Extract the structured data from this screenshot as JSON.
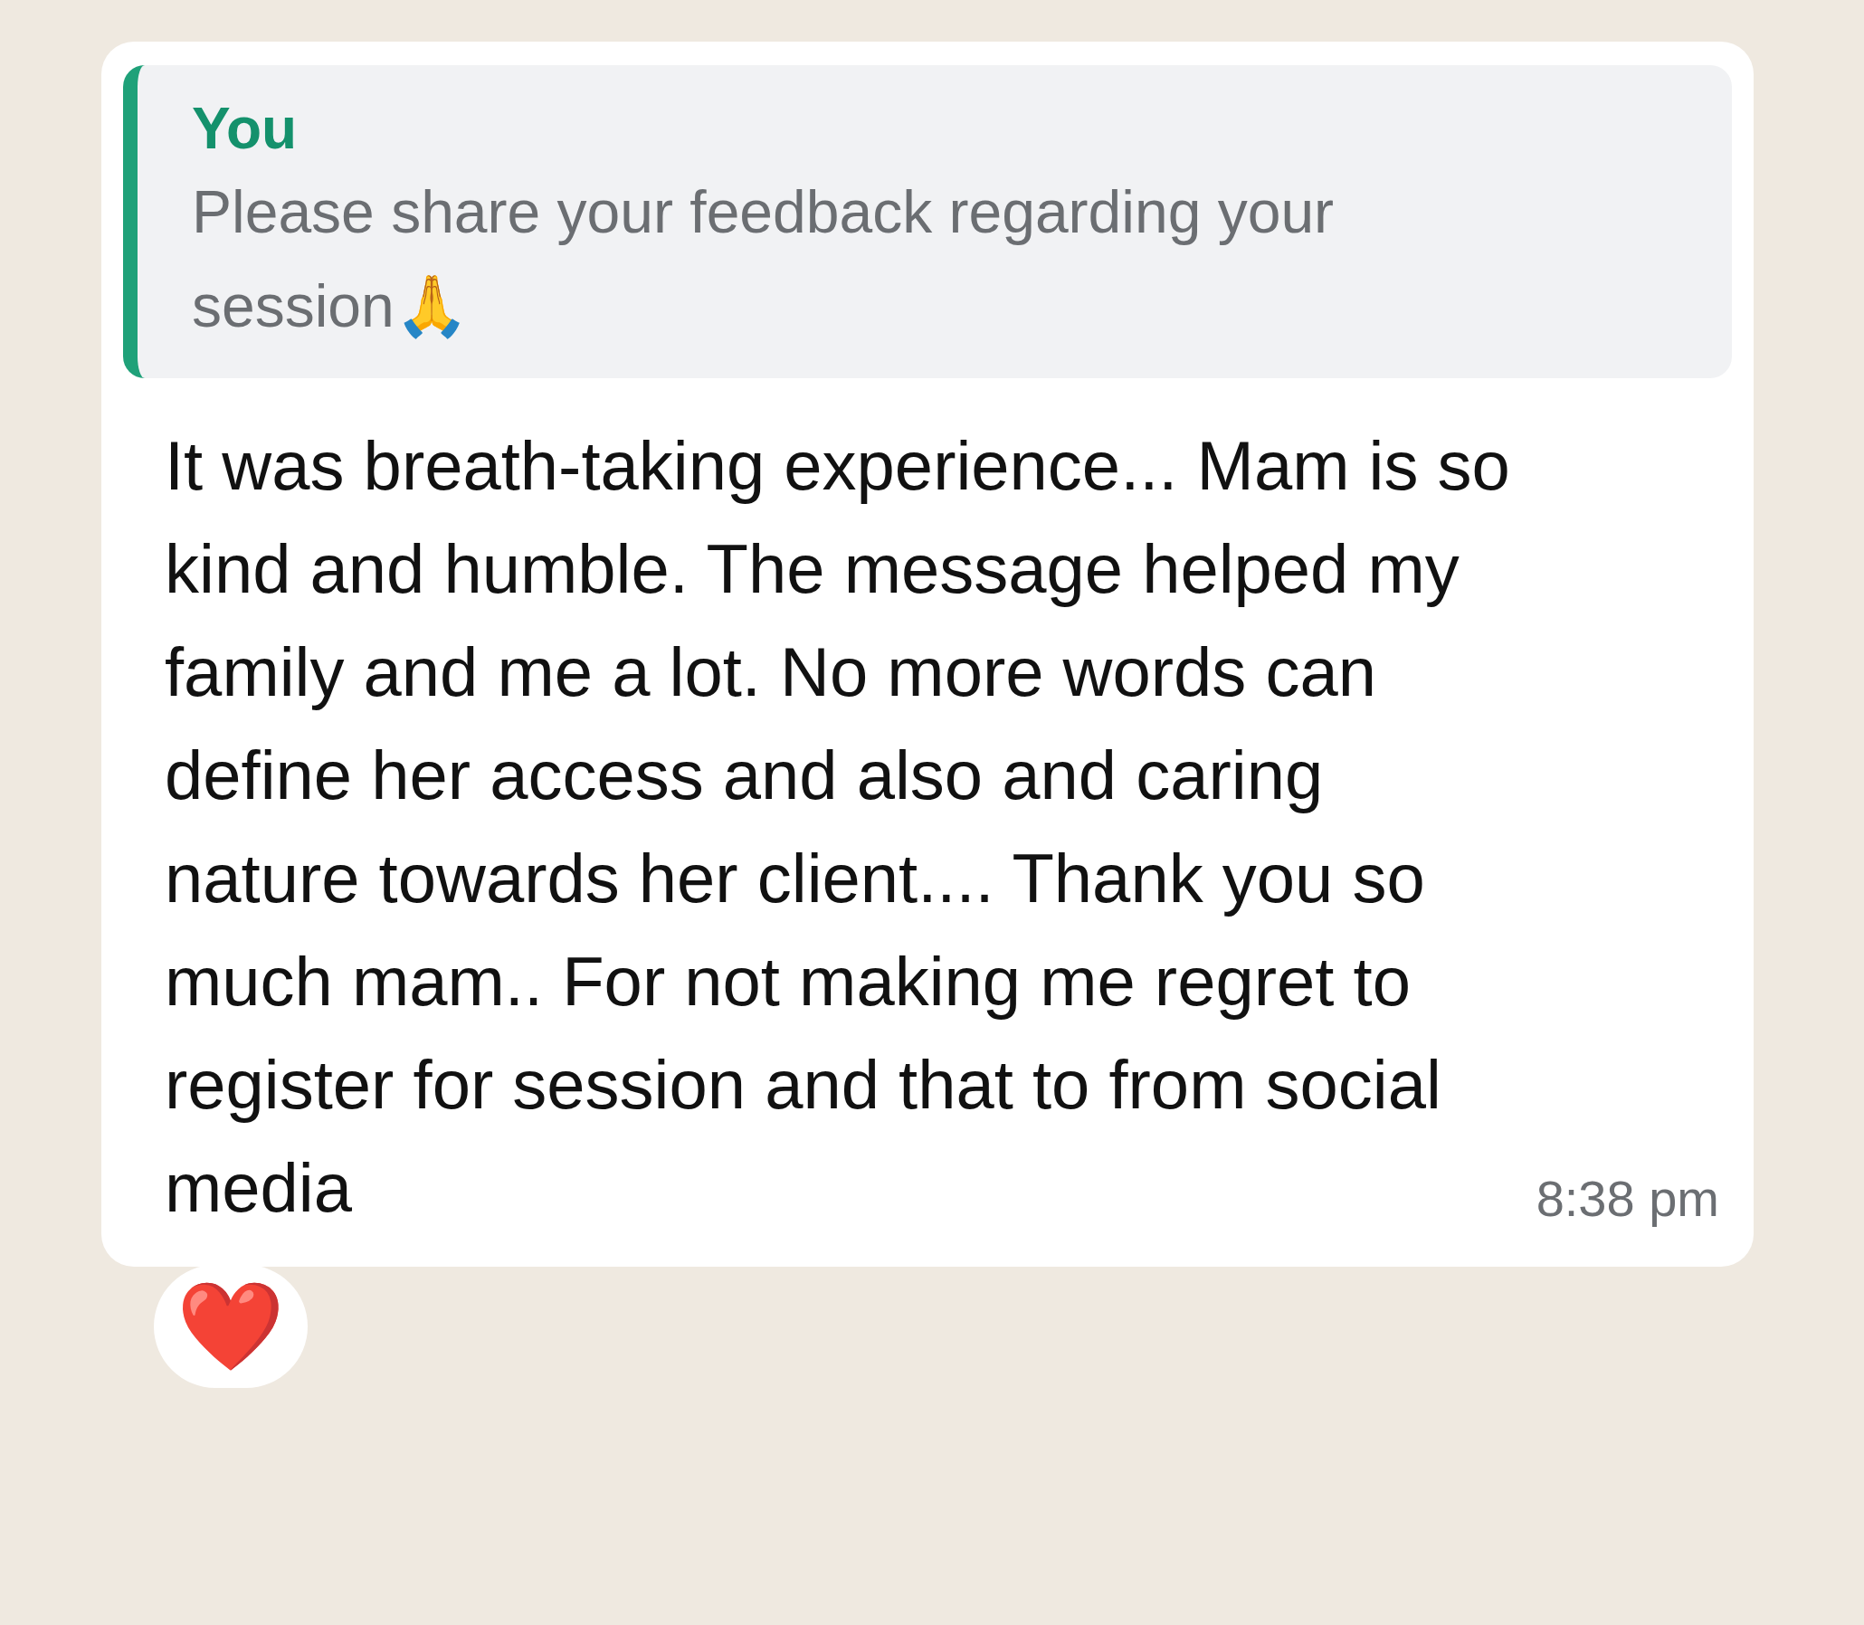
{
  "message": {
    "quoted": {
      "author": "You",
      "text": "Please share your feedback regarding your session🙏"
    },
    "text": "It was breath-taking experience... Mam is so kind and humble. The message helped my family and me a lot. No more words can define her access and also and caring nature towards her client.... Thank you so much mam.. For not making me regret to register for session and that to from social media",
    "time": "8:38 pm",
    "reactions": [
      "❤️"
    ]
  }
}
